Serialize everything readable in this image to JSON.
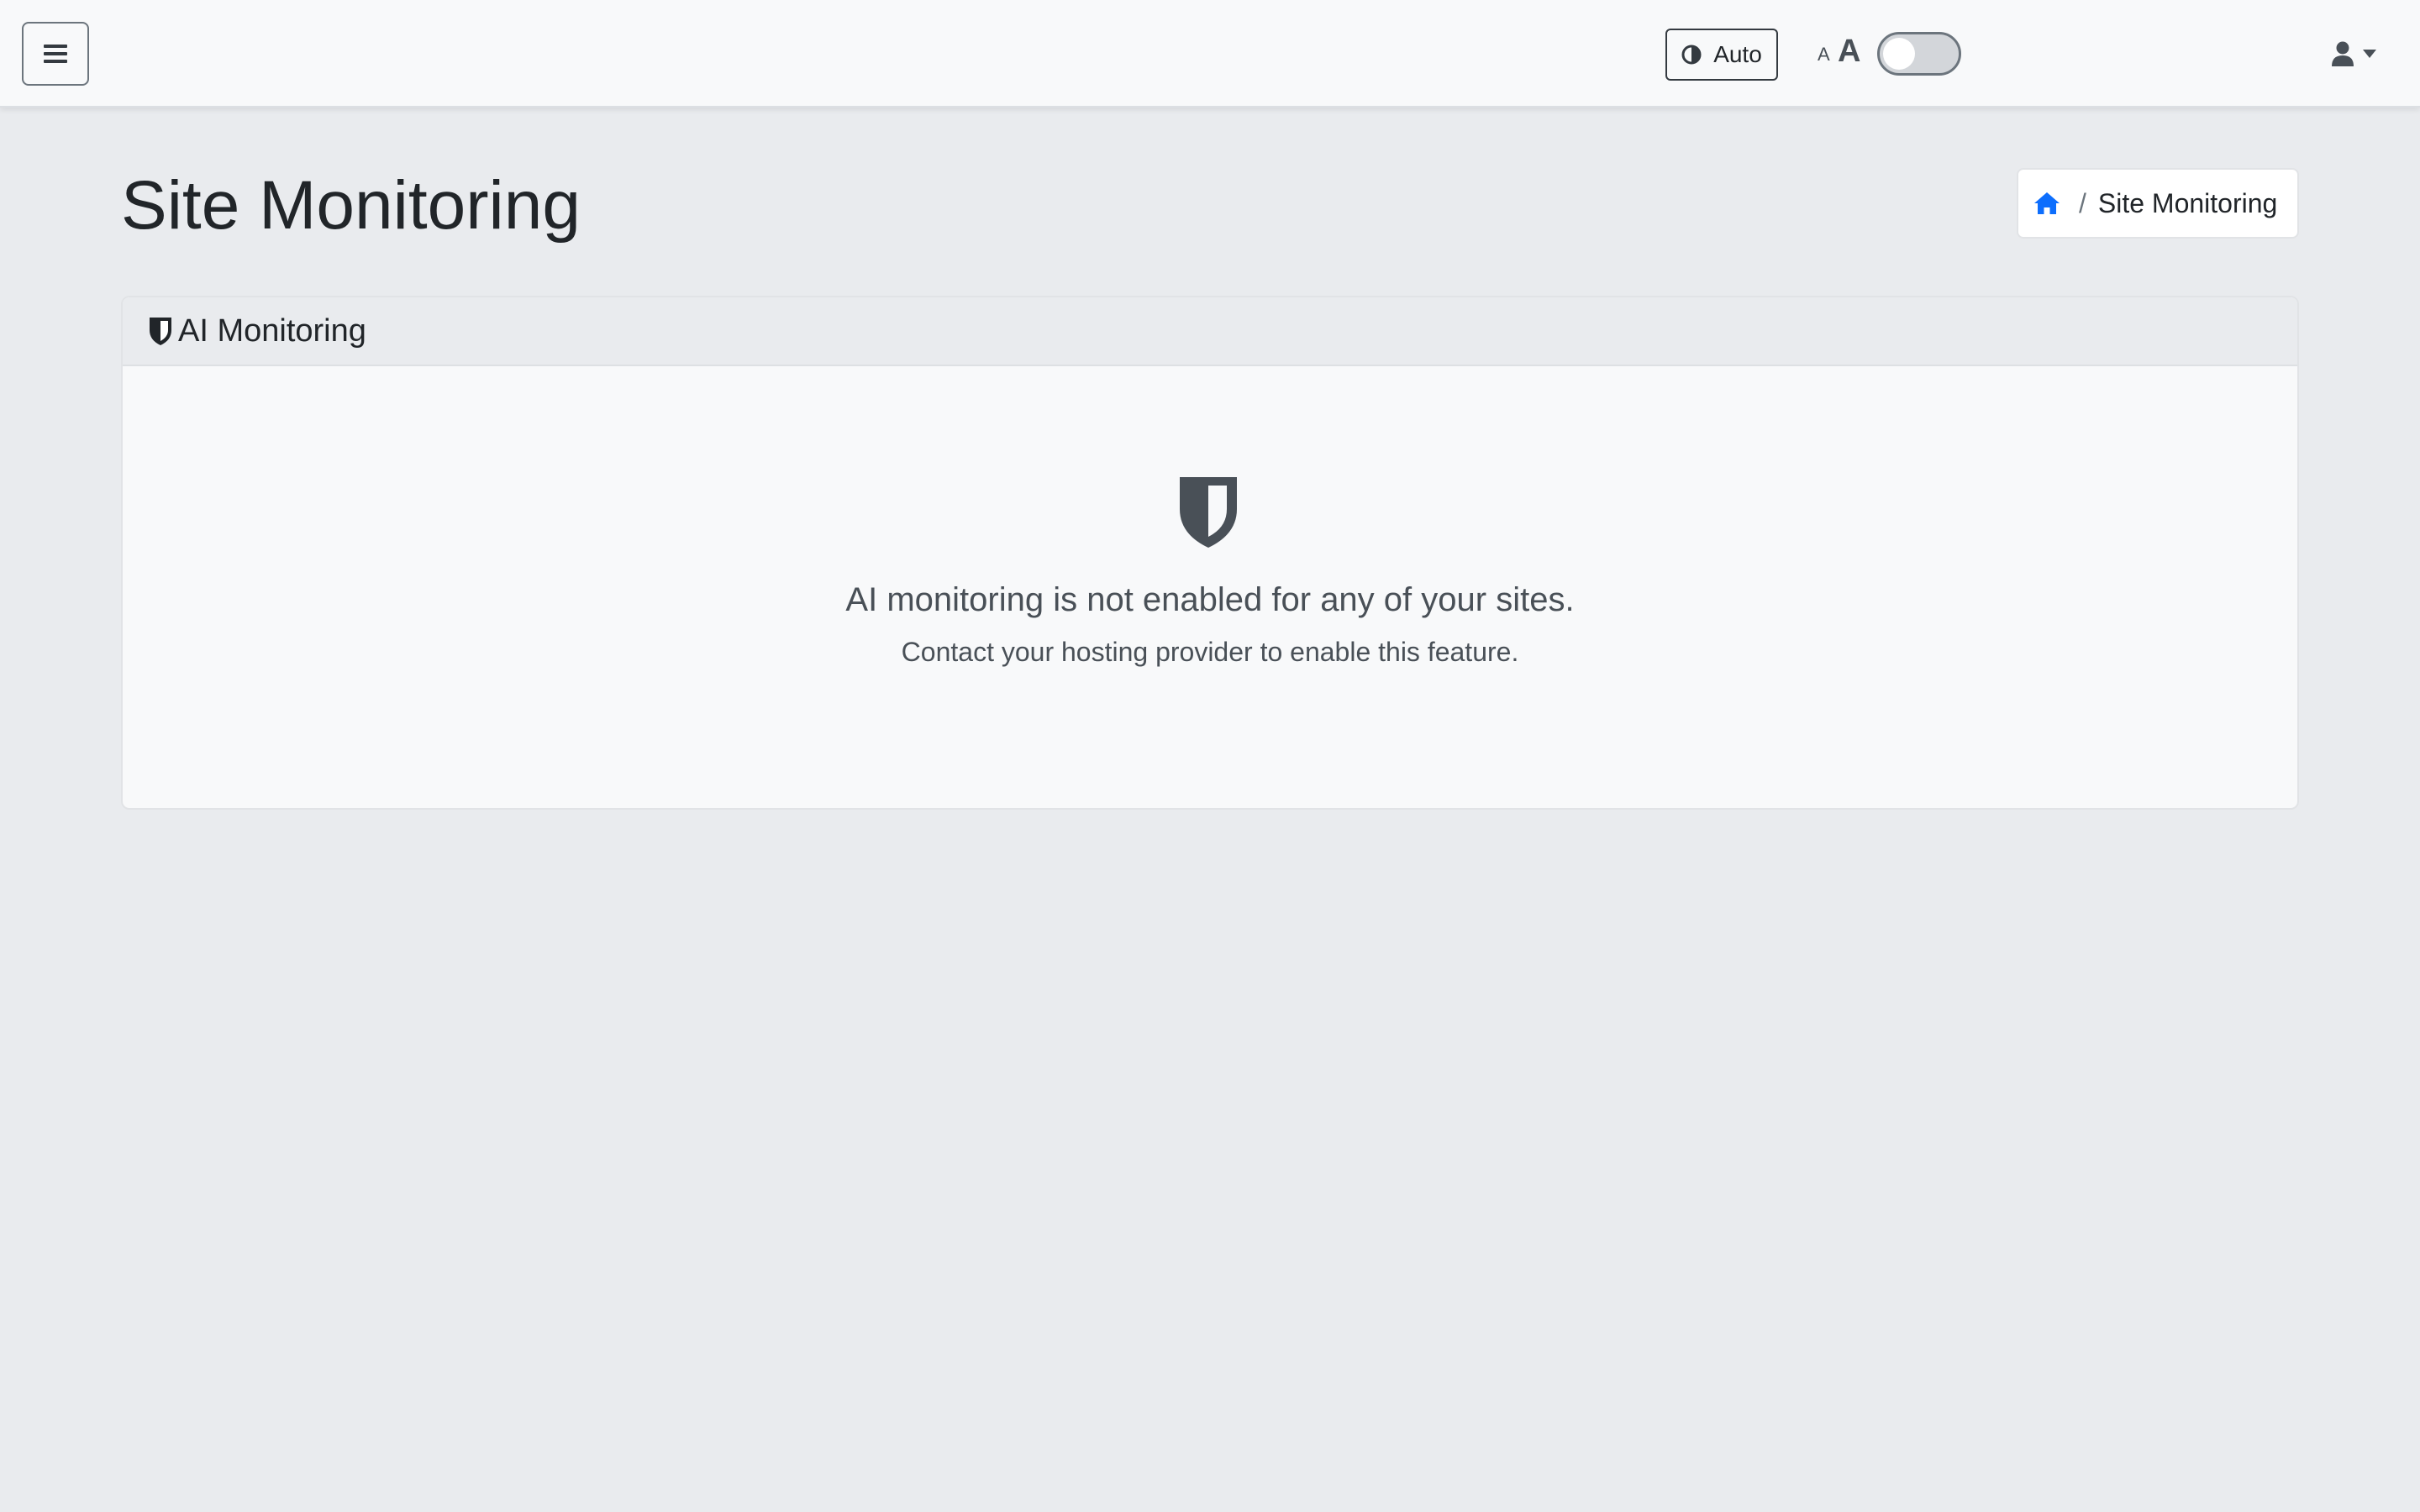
{
  "topbar": {
    "menu_icon": "hamburger-menu-icon",
    "theme_label": "Auto",
    "theme_icon": "contrast-icon",
    "font_small": "A",
    "font_large": "A",
    "font_toggle_on": false,
    "user_icon": "user-icon",
    "caret_icon": "chevron-down-icon"
  },
  "page": {
    "title": "Site Monitoring"
  },
  "breadcrumb": {
    "home_icon": "home-icon",
    "separator": "/",
    "current": "Site Monitoring"
  },
  "card": {
    "header_icon": "shield-icon",
    "title": "AI Monitoring",
    "empty_icon": "shield-icon",
    "empty_message": "AI monitoring is not enabled for any of your sites.",
    "empty_hint": "Contact your hosting provider to enable this feature."
  },
  "colors": {
    "background": "#e9ebee",
    "topbar": "#f8f9fa",
    "link": "#0d6efd",
    "icon_dark": "#495057"
  }
}
